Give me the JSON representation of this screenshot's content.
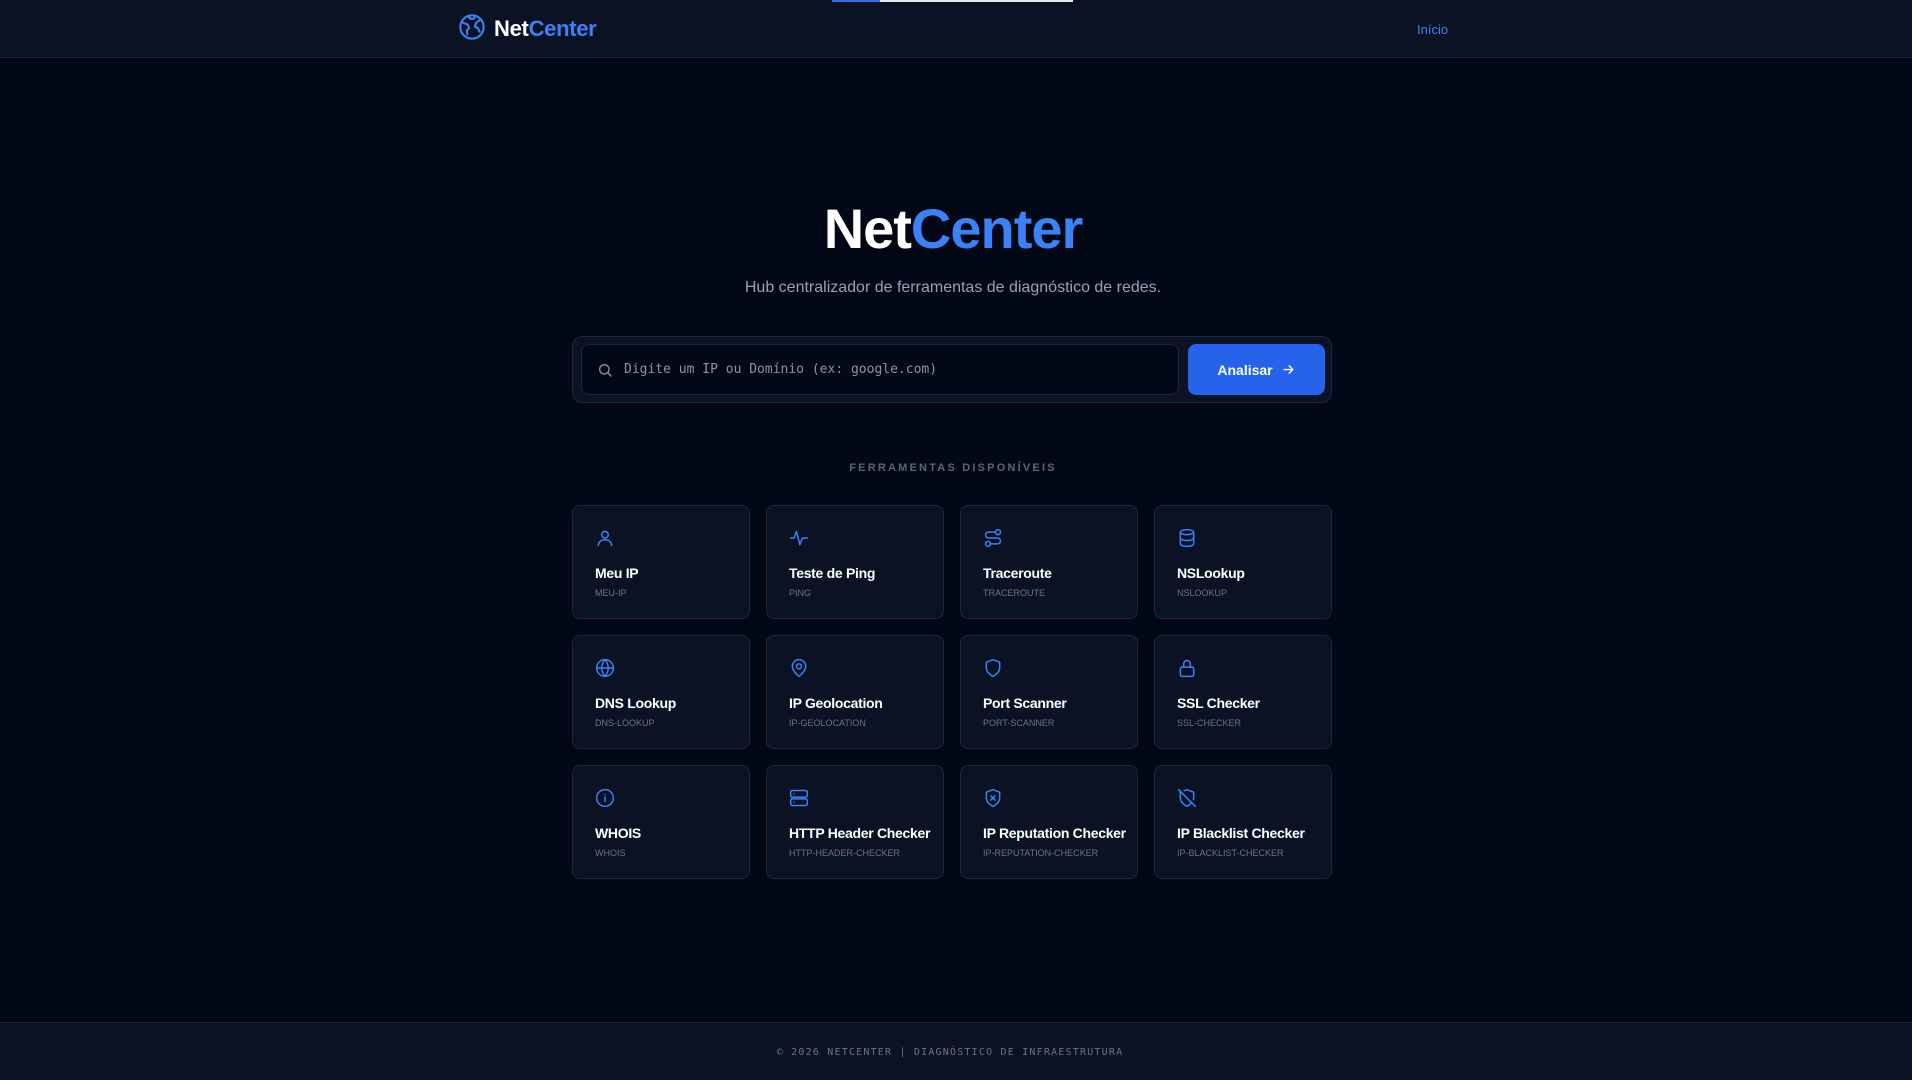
{
  "header": {
    "brand_part1": "Net",
    "brand_part2": "Center",
    "nav_home": "Início",
    "logo_icon": "globe-network-icon"
  },
  "hero": {
    "title_part1": "Net",
    "title_part2": "Center",
    "subtitle": "Hub centralizador de ferramentas de diagnóstico de redes."
  },
  "search": {
    "placeholder": "Digite um IP ou Domínio (ex: google.com)",
    "value": "",
    "button_label": "Analisar"
  },
  "tools_section": {
    "label": "FERRAMENTAS DISPONÍVEIS",
    "items": [
      {
        "title": "Meu IP",
        "slug": "MEU-IP",
        "icon": "user-icon"
      },
      {
        "title": "Teste de Ping",
        "slug": "PING",
        "icon": "activity-icon"
      },
      {
        "title": "Traceroute",
        "slug": "TRACEROUTE",
        "icon": "route-icon"
      },
      {
        "title": "NSLookup",
        "slug": "NSLOOKUP",
        "icon": "database-icon"
      },
      {
        "title": "DNS Lookup",
        "slug": "DNS-LOOKUP",
        "icon": "globe-icon"
      },
      {
        "title": "IP Geolocation",
        "slug": "IP-GEOLOCATION",
        "icon": "map-pin-icon"
      },
      {
        "title": "Port Scanner",
        "slug": "PORT-SCANNER",
        "icon": "shield-icon"
      },
      {
        "title": "SSL Checker",
        "slug": "SSL-CHECKER",
        "icon": "lock-icon"
      },
      {
        "title": "WHOIS",
        "slug": "WHOIS",
        "icon": "info-icon"
      },
      {
        "title": "HTTP Header Checker",
        "slug": "HTTP-HEADER-CHECKER",
        "icon": "server-icon"
      },
      {
        "title": "IP Reputation Checker",
        "slug": "IP-REPUTATION-CHECKER",
        "icon": "shield-x-icon"
      },
      {
        "title": "IP Blacklist Checker",
        "slug": "IP-BLACKLIST-CHECKER",
        "icon": "shield-off-icon"
      }
    ]
  },
  "footer": {
    "text": "© 2026 NETCENTER | DIAGNÓSTICO DE INFRAESTRUTURA"
  },
  "colors": {
    "background": "#030816",
    "surface": "#0b1224",
    "accent": "#3b82f6",
    "button": "#2563eb"
  }
}
